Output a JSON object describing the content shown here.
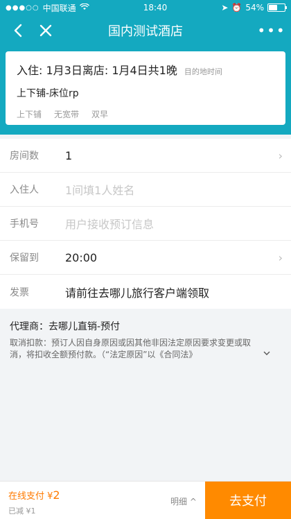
{
  "status_bar": {
    "carrier": "中国联通",
    "time": "18:40",
    "battery": "54%",
    "battery_level": 0.54
  },
  "nav": {
    "title": "国内测试酒店",
    "more": "•••"
  },
  "booking": {
    "stay": "入住: 1月3日离店: 1月4日共1晚",
    "stay_hint": "目的地时间",
    "room_name": "上下铺-床位rp",
    "tags": [
      "上下铺",
      "无宽带",
      "双早"
    ]
  },
  "form": {
    "rooms": {
      "label": "房间数",
      "value": "1"
    },
    "guest": {
      "label": "入住人",
      "placeholder": "1间填1人姓名"
    },
    "phone": {
      "label": "手机号",
      "placeholder": "用户接收预订信息"
    },
    "hold": {
      "label": "保留到",
      "value": "20:00"
    },
    "invoice": {
      "label": "发票",
      "value": "请前往去哪儿旅行客户端领取"
    }
  },
  "agent": "代理商：去哪儿直销-预付",
  "cancel_policy": "取消扣款：预订人因自身原因或因其他非因法定原因要求变更或取消，将扣收全额预付款。（“法定原因”以《合同法》",
  "footer": {
    "pay_label": "在线支付 ¥",
    "pay_amount": "2",
    "discount": "已减 ¥1",
    "detail": "明细",
    "pay_button": "去支付"
  }
}
